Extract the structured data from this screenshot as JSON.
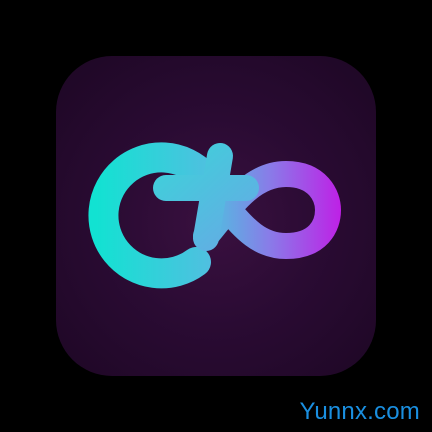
{
  "logo": {
    "icon_name": "cx-infinity-logo-icon",
    "background_color": "#25092d",
    "gradient_start": "#12e2d2",
    "gradient_mid": "#6a9ae6",
    "gradient_end": "#c21ae6"
  },
  "watermark": {
    "text": "Yunnx.com",
    "color": "#1a8fe0"
  }
}
